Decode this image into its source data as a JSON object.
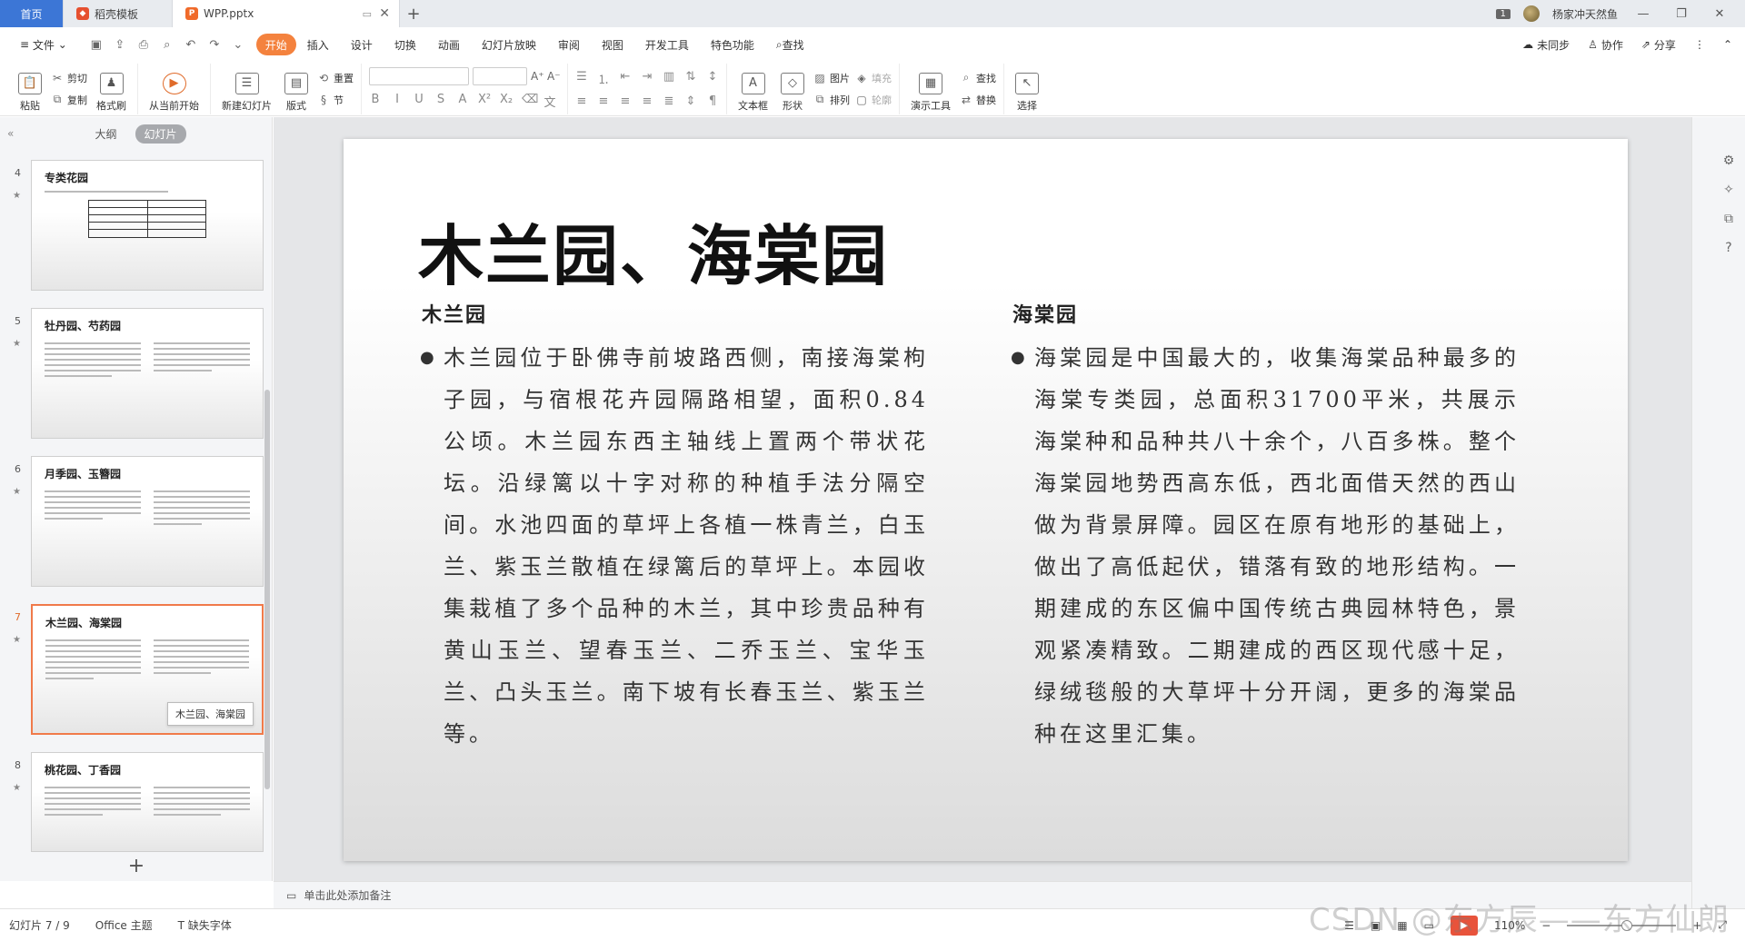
{
  "tabs": {
    "home": "首页",
    "templates": "稻壳模板",
    "doc": "WPP.pptx",
    "window_badge": "1",
    "user": "杨家冲天然鱼"
  },
  "menu": {
    "file": "文件",
    "items": [
      "开始",
      "插入",
      "设计",
      "切换",
      "动画",
      "幻灯片放映",
      "审阅",
      "视图",
      "开发工具",
      "特色功能"
    ],
    "search": "查找",
    "sync": "未同步",
    "collab": "协作",
    "share": "分享"
  },
  "ribbon": {
    "paste": "粘贴",
    "cut": "剪切",
    "copy": "复制",
    "format_painter": "格式刷",
    "from_current": "从当前开始",
    "new_slide": "新建幻灯片",
    "layout": "版式",
    "reset": "重置",
    "section": "节",
    "textbox": "文本框",
    "shape": "形状",
    "picture": "图片",
    "fill": "填充",
    "arrange": "排列",
    "outline": "轮廓",
    "present_tools": "演示工具",
    "find": "查找",
    "replace": "替换",
    "select": "选择"
  },
  "panel": {
    "outline_tab": "大纲",
    "slides_tab": "幻灯片",
    "tooltip": "木兰园、海棠园",
    "thumbs": [
      {
        "num": "4",
        "title": "专类花园"
      },
      {
        "num": "5",
        "title": "牡丹园、芍药园"
      },
      {
        "num": "6",
        "title": "月季园、玉簪园"
      },
      {
        "num": "7",
        "title": "木兰园、海棠园"
      },
      {
        "num": "8",
        "title": "桃花园、丁香园"
      }
    ]
  },
  "slide": {
    "title": "木兰园、海棠园",
    "left_head": "木兰园",
    "left_body": "木兰园位于卧佛寺前坡路西侧，南接海棠枸子园，与宿根花卉园隔路相望，面积0.84公顷。木兰园东西主轴线上置两个带状花坛。沿绿篱以十字对称的种植手法分隔空间。水池四面的草坪上各植一株青兰，白玉兰、紫玉兰散植在绿篱后的草坪上。本园收集栽植了多个品种的木兰，其中珍贵品种有黄山玉兰、望春玉兰、二乔玉兰、宝华玉兰、凸头玉兰。南下坡有长春玉兰、紫玉兰等。",
    "right_head": "海棠园",
    "right_body": "海棠园是中国最大的，收集海棠品种最多的海棠专类园，总面积31700平米，共展示海棠种和品种共八十余个，八百多株。整个海棠园地势西高东低，西北面借天然的西山做为背景屏障。园区在原有地形的基础上，做出了高低起伏，错落有致的地形结构。一期建成的东区偏中国传统古典园林特色，景观紧凑精致。二期建成的西区现代感十足，绿绒毯般的大草坪十分开阔，更多的海棠品种在这里汇集。"
  },
  "notes_placeholder": "单击此处添加备注",
  "status": {
    "slide_pos": "幻灯片 7 / 9",
    "theme": "Office 主题",
    "missing_font": "缺失字体",
    "zoom": "110%"
  },
  "watermark": "CSDN @东方辰——东方仙朗",
  "colors": {
    "accent": "#f4823e",
    "home_tab": "#3c76d6",
    "active_thumb": "#f07a4a"
  }
}
